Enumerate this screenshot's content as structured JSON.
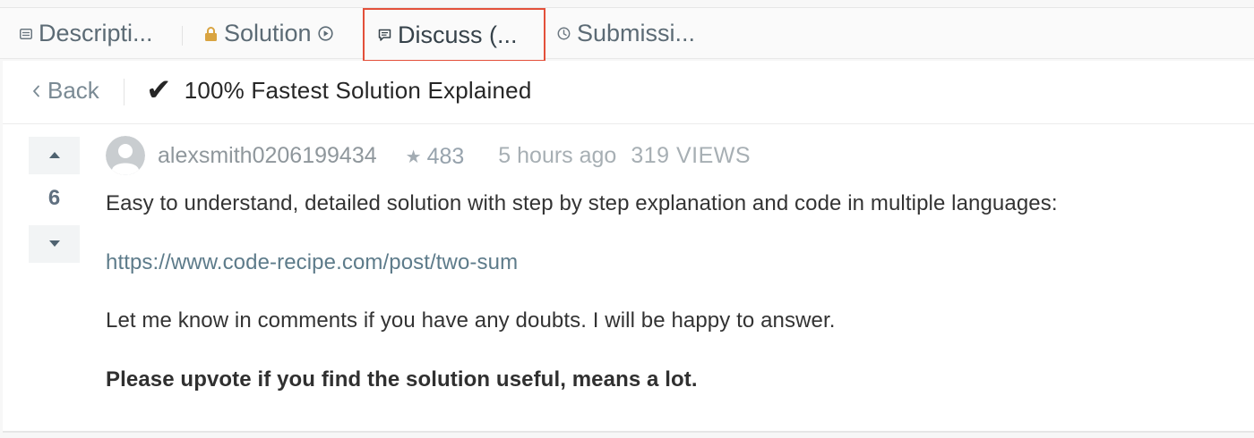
{
  "tabs": [
    {
      "label": "Descripti...",
      "icon": "description-icon"
    },
    {
      "label": "Solution",
      "icon": "lock-icon",
      "trailing_icon": "play-circle-icon"
    },
    {
      "label": "Discuss (...",
      "icon": "comment-icon",
      "active": true
    },
    {
      "label": "Submissi...",
      "icon": "clock-icon"
    }
  ],
  "topic": {
    "back_label": "Back",
    "title": "100% Fastest Solution Explained"
  },
  "post": {
    "votes": "6",
    "author": "alexsmith0206199434",
    "reputation": "483",
    "timestamp": "5 hours ago",
    "views": "319 VIEWS",
    "paragraphs": [
      "Easy to understand, detailed solution with step by step explanation and code in multiple languages:",
      "https://www.code-recipe.com/post/two-sum",
      "Let me know in comments if you have any doubts. I will be happy to answer.",
      "Please upvote if you find the solution useful, means a lot."
    ]
  },
  "colors": {
    "highlight_border": "#e3503a",
    "lock_icon": "#d9a441",
    "link": "#5d7b8a"
  }
}
